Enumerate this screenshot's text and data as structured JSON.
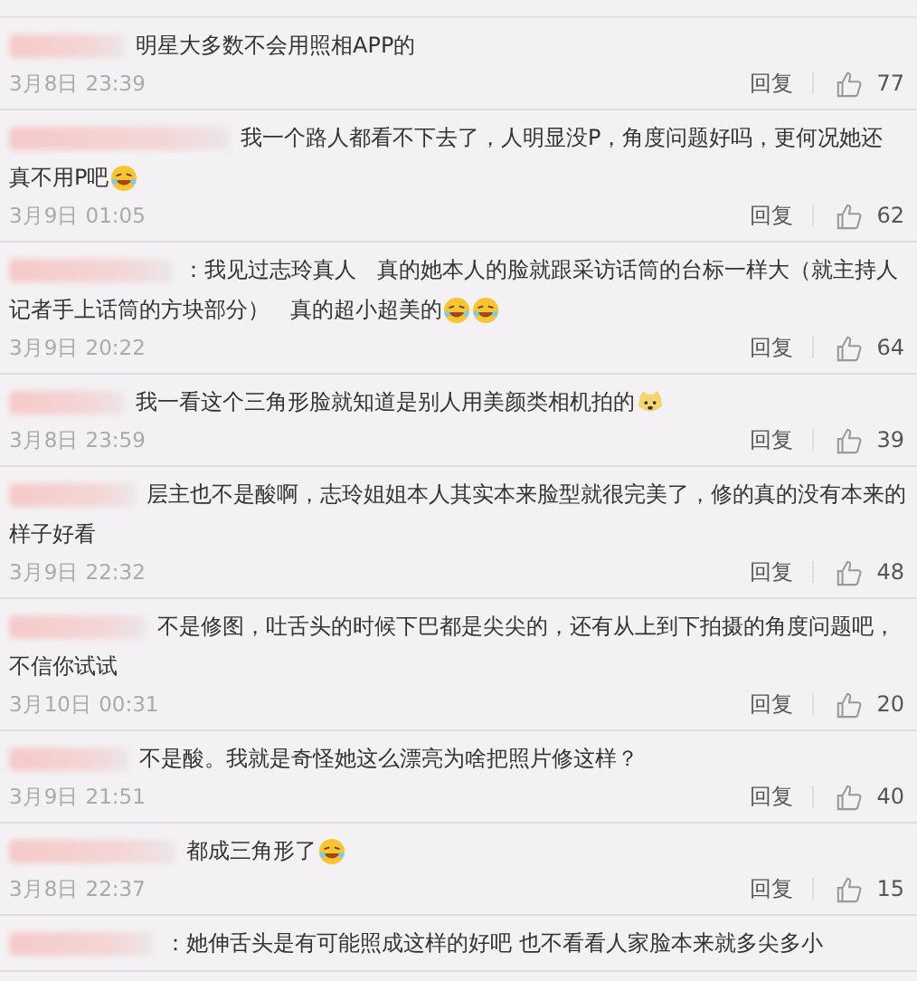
{
  "comments": [
    {
      "lines": [
        "明星大多数不会用照相APP的"
      ],
      "time": "3月8日 23:39",
      "reply": "回复",
      "likes": "77"
    },
    {
      "lines": [
        "我一个路人都看不下去了，人明显没P，角度问题好吗，更何况她还",
        "真不用P吧"
      ],
      "emojis": [
        {
          "kind": "laugh"
        }
      ],
      "time": "3月9日 01:05",
      "reply": "回复",
      "likes": "62"
    },
    {
      "lines": [
        "：我见过志玲真人   真的她本人的脸就跟采访话筒的台标一样大（就主持人",
        "记者手上话筒的方块部分）   真的超小超美的"
      ],
      "emojis": [
        {
          "kind": "laugh"
        },
        {
          "kind": "laugh"
        }
      ],
      "time": "3月9日 20:22",
      "reply": "回复",
      "likes": "64"
    },
    {
      "lines": [
        "我一看这个三角形脸就知道是别人用美颜类相机拍的"
      ],
      "emojis": [
        {
          "kind": "dog"
        }
      ],
      "time": "3月8日 23:59",
      "reply": "回复",
      "likes": "39"
    },
    {
      "lines": [
        "层主也不是酸啊，志玲姐姐本人其实本来脸型就很完美了，修的真的没有本来的",
        "样子好看"
      ],
      "time": "3月9日 22:32",
      "reply": "回复",
      "likes": "48"
    },
    {
      "lines": [
        "不是修图，吐舌头的时候下巴都是尖尖的，还有从上到下拍摄的角度问题吧，",
        "不信你试试"
      ],
      "time": "3月10日 00:31",
      "reply": "回复",
      "likes": "20"
    },
    {
      "lines": [
        "不是酸。我就是奇怪她这么漂亮为啥把照片修这样？"
      ],
      "time": "3月9日 21:51",
      "reply": "回复",
      "likes": "40"
    },
    {
      "lines": [
        "都成三角形了"
      ],
      "emojis": [
        {
          "kind": "laugh"
        }
      ],
      "time": "3月8日 22:37",
      "reply": "回复",
      "likes": "15"
    },
    {
      "lines": [
        "：她伸舌头是有可能照成这样的好吧 也不看看人家脸本来就多尖多小"
      ]
    }
  ]
}
